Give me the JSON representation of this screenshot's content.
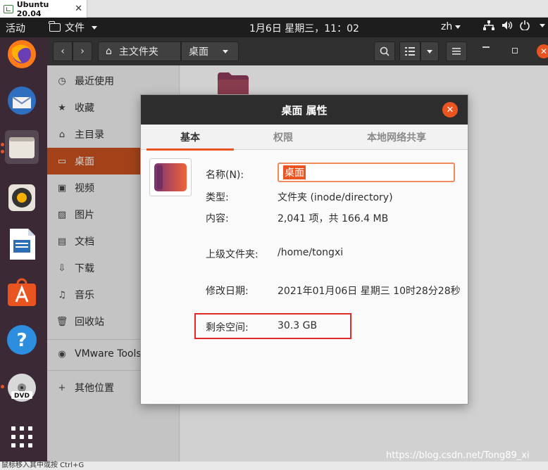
{
  "vm": {
    "tab_title": "Ubuntu 20.04",
    "tab_close": "✕"
  },
  "topbar": {
    "activities": "活动",
    "app_menu": "文件",
    "clock": "1月6日 星期三，11：02",
    "lang": "zh"
  },
  "dock": {
    "items": [
      {
        "name": "Firefox",
        "icon": "firefox-icon"
      },
      {
        "name": "Thunderbird",
        "icon": "thunderbird-icon"
      },
      {
        "name": "Files",
        "icon": "files-icon",
        "active": true
      },
      {
        "name": "Rhythmbox",
        "icon": "rhythmbox-icon"
      },
      {
        "name": "LibreOffice Writer",
        "icon": "writer-icon"
      },
      {
        "name": "Ubuntu Software",
        "icon": "software-icon"
      },
      {
        "name": "Help",
        "icon": "help-icon"
      },
      {
        "name": "DVD",
        "icon": "dvd-icon"
      },
      {
        "name": "Show Applications",
        "icon": "app-grid-icon"
      }
    ]
  },
  "files": {
    "path": {
      "home": "主文件夹",
      "current": "桌面"
    },
    "sidebar": [
      {
        "label": "最近使用",
        "icon": "◷"
      },
      {
        "label": "收藏",
        "icon": "★"
      },
      {
        "label": "主目录",
        "icon": "⌂"
      },
      {
        "label": "桌面",
        "icon": "▭",
        "active": true
      },
      {
        "label": "视频",
        "icon": "▣"
      },
      {
        "label": "图片",
        "icon": "▨"
      },
      {
        "label": "文档",
        "icon": "▤"
      },
      {
        "label": "下载",
        "icon": "⇩"
      },
      {
        "label": "音乐",
        "icon": "♫"
      },
      {
        "label": "回收站",
        "icon": "🗑"
      },
      {
        "label": "VMware Tools",
        "icon": "◉"
      },
      {
        "label": "其他位置",
        "icon": "+"
      }
    ]
  },
  "dialog": {
    "title": "桌面 属性",
    "close": "✕",
    "tabs": [
      "基本",
      "权限",
      "本地网络共享"
    ],
    "fields": {
      "name_label": "名称(N):",
      "name_value": "桌面",
      "type_label": "类型:",
      "type_value": "文件夹 (inode/directory)",
      "contents_label": "内容:",
      "contents_value": "2,041 项，共 166.4 MB",
      "parent_label": "上级文件夹:",
      "parent_value": "/home/tongxi",
      "modified_label": "修改日期:",
      "modified_value": "2021年01月06日 星期三 10时28分28秒",
      "free_label": "剩余空间:",
      "free_value": "30.3 GB"
    }
  },
  "watermark": "https://blog.csdn.net/Tong89_xi",
  "bottom_hint": "鼠标移入其中或按 Ctrl+G"
}
